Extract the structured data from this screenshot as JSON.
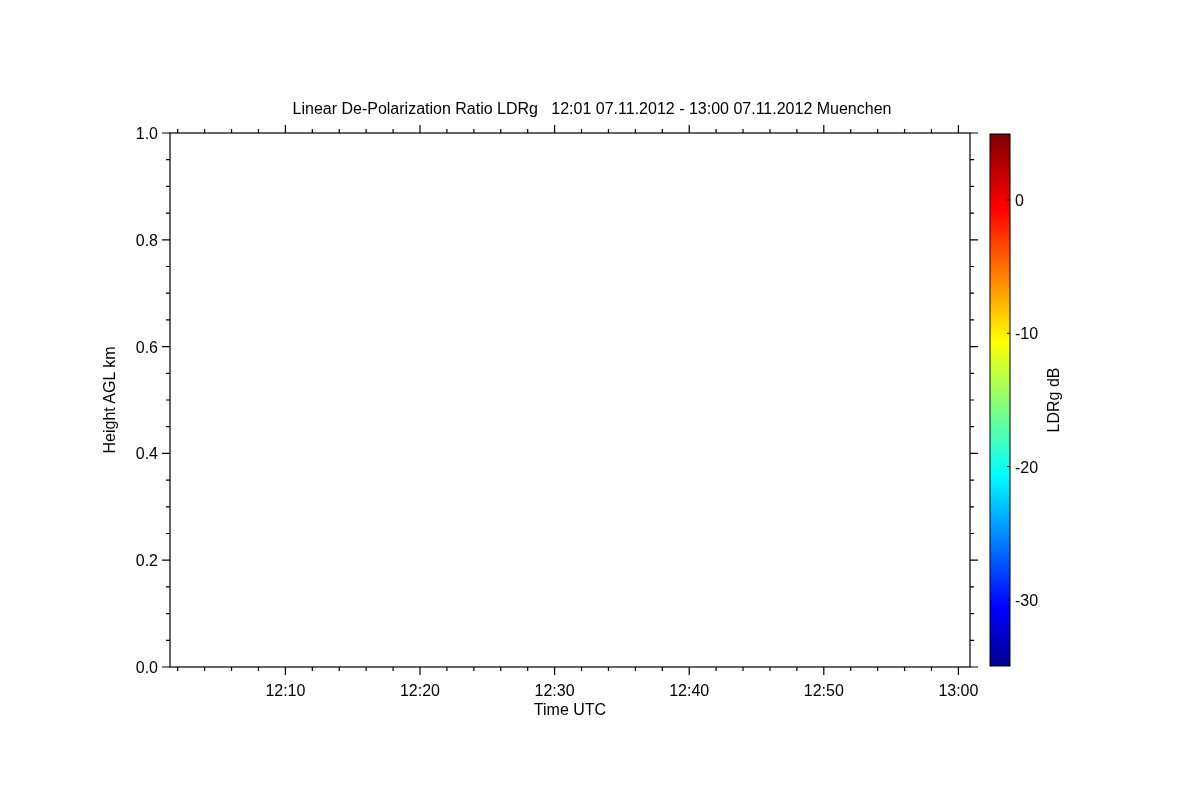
{
  "plot": {
    "chart_data": {
      "type": "scatter",
      "title": "Linear De-Polarization Ratio LDRg   12:01 07.11.2012 - 13:00 07.11.2012 Muenchen",
      "xlabel": "Time UTC",
      "ylabel": "Height AGL km",
      "ylim": [
        0,
        1
      ],
      "categories": [
        "12:10",
        "12:20",
        "12:30",
        "12:40",
        "12:50",
        "13:00"
      ],
      "yticks": [
        {
          "value": 0,
          "label": "0.0"
        },
        {
          "value": 0.2,
          "label": "0.2"
        },
        {
          "value": 0.4,
          "label": "0.4"
        },
        {
          "value": 0.6,
          "label": "0.6"
        },
        {
          "value": 0.8,
          "label": "0.8"
        },
        {
          "value": 1,
          "label": "1.0"
        }
      ]
    }
  },
  "colorbar": {
    "label": "LDRg dB",
    "tick_labels": [
      "0",
      "-10",
      "-20",
      "-30"
    ]
  }
}
